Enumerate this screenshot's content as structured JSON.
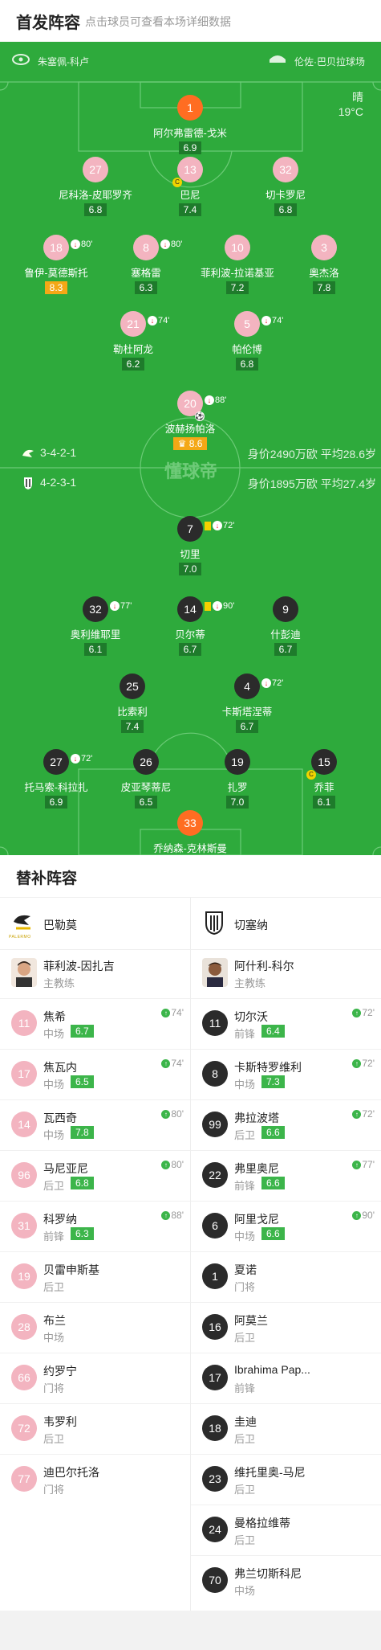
{
  "header": {
    "title": "首发阵容",
    "subtitle": "点击球员可查看本场详细数据"
  },
  "pitch": {
    "home_venue_label": "朱塞佩-科卢",
    "away_venue_label": "伦佐·巴贝拉球场",
    "weather": "晴",
    "temperature": "19°C",
    "watermark": "懂球帝",
    "home_formation": "3-4-2-1",
    "home_value": "身价2490万欧 平均28.6岁",
    "away_formation": "4-2-3-1",
    "away_value": "身价1895万欧 平均27.4岁"
  },
  "home_players": [
    {
      "num": "1",
      "name": "阿尔弗雷德-戈米",
      "rating": "6.9",
      "gk": true
    },
    {
      "num": "27",
      "name": "尼科洛-皮耶罗齐",
      "rating": "6.8"
    },
    {
      "num": "13",
      "name": "巴尼",
      "rating": "7.4",
      "captain": true
    },
    {
      "num": "32",
      "name": "切卡罗尼",
      "rating": "6.8"
    },
    {
      "num": "18",
      "name": "鲁伊-莫德斯托",
      "rating": "8.3",
      "sub_min": "80'",
      "hi": true
    },
    {
      "num": "8",
      "name": "塞格雷",
      "rating": "6.3",
      "sub_min": "80'"
    },
    {
      "num": "10",
      "name": "菲利波-拉诺基亚",
      "rating": "7.2"
    },
    {
      "num": "3",
      "name": "奥杰洛",
      "rating": "7.8"
    },
    {
      "num": "21",
      "name": "勒杜阿龙",
      "rating": "6.2",
      "sub_min": "74'"
    },
    {
      "num": "5",
      "name": "帕伦博",
      "rating": "6.8",
      "sub_min": "74'"
    },
    {
      "num": "20",
      "name": "波赫扬帕洛",
      "rating": "8.6",
      "sub_min": "88'",
      "hi": true,
      "best": true
    }
  ],
  "away_players": [
    {
      "num": "7",
      "name": "切里",
      "rating": "7.0",
      "sub_min": "72'",
      "yellow": true
    },
    {
      "num": "32",
      "name": "奥利维耶里",
      "rating": "6.1",
      "sub_min": "77'"
    },
    {
      "num": "14",
      "name": "贝尔蒂",
      "rating": "6.7",
      "sub_min": "90'",
      "yellow": true
    },
    {
      "num": "9",
      "name": "什彭迪",
      "rating": "6.7"
    },
    {
      "num": "25",
      "name": "比索利",
      "rating": "7.4"
    },
    {
      "num": "4",
      "name": "卡斯塔涅蒂",
      "rating": "6.7",
      "sub_min": "72'"
    },
    {
      "num": "27",
      "name": "托马索-科拉扎",
      "rating": "6.9",
      "sub_min": "72'"
    },
    {
      "num": "26",
      "name": "皮亚琴蒂尼",
      "rating": "6.5"
    },
    {
      "num": "19",
      "name": "扎罗",
      "rating": "7.0"
    },
    {
      "num": "15",
      "name": "乔菲",
      "rating": "6.1",
      "captain": true
    },
    {
      "num": "33",
      "name": "乔纳森-克林斯曼",
      "rating": "6.9",
      "gk": true
    }
  ],
  "subs_section": {
    "title": "替补阵容",
    "home": {
      "team": "巴勒莫",
      "logo_text": "PALERMO",
      "coach": "菲利波-因扎吉",
      "coach_role": "主教练",
      "players": [
        {
          "num": "11",
          "name": "焦希",
          "pos": "中场",
          "rating": "6.7",
          "min": "74'"
        },
        {
          "num": "17",
          "name": "焦瓦内",
          "pos": "中场",
          "rating": "6.5",
          "min": "74'"
        },
        {
          "num": "14",
          "name": "瓦西奇",
          "pos": "中场",
          "rating": "7.8",
          "min": "80'"
        },
        {
          "num": "96",
          "name": "马尼亚尼",
          "pos": "后卫",
          "rating": "6.8",
          "min": "80'"
        },
        {
          "num": "31",
          "name": "科罗纳",
          "pos": "前锋",
          "rating": "6.3",
          "min": "88'"
        },
        {
          "num": "19",
          "name": "贝雷申斯基",
          "pos": "后卫"
        },
        {
          "num": "28",
          "name": "布兰",
          "pos": "中场"
        },
        {
          "num": "66",
          "name": "约罗宁",
          "pos": "门将"
        },
        {
          "num": "72",
          "name": "韦罗利",
          "pos": "后卫"
        },
        {
          "num": "77",
          "name": "迪巴尔托洛",
          "pos": "门将"
        }
      ]
    },
    "away": {
      "team": "切塞纳",
      "coach": "阿什利-科尔",
      "coach_role": "主教练",
      "players": [
        {
          "num": "11",
          "name": "切尔沃",
          "pos": "前锋",
          "rating": "6.4",
          "min": "72'"
        },
        {
          "num": "8",
          "name": "卡斯特罗维利",
          "pos": "中场",
          "rating": "7.3",
          "min": "72'"
        },
        {
          "num": "99",
          "name": "弗拉波塔",
          "pos": "后卫",
          "rating": "6.6",
          "min": "72'"
        },
        {
          "num": "22",
          "name": "弗里奥尼",
          "pos": "前锋",
          "rating": "6.6",
          "min": "77'"
        },
        {
          "num": "6",
          "name": "阿里戈尼",
          "pos": "中场",
          "rating": "6.6",
          "min": "90'"
        },
        {
          "num": "1",
          "name": "夏诺",
          "pos": "门将"
        },
        {
          "num": "16",
          "name": "阿莫兰",
          "pos": "后卫"
        },
        {
          "num": "17",
          "name": "Ibrahima Pap...",
          "pos": "前锋"
        },
        {
          "num": "18",
          "name": "圭迪",
          "pos": "后卫"
        },
        {
          "num": "23",
          "name": "维托里奥-马尼",
          "pos": "后卫"
        },
        {
          "num": "24",
          "name": "曼格拉维蒂",
          "pos": "后卫"
        },
        {
          "num": "70",
          "name": "弗兰切斯科尼",
          "pos": "中场"
        }
      ]
    }
  }
}
